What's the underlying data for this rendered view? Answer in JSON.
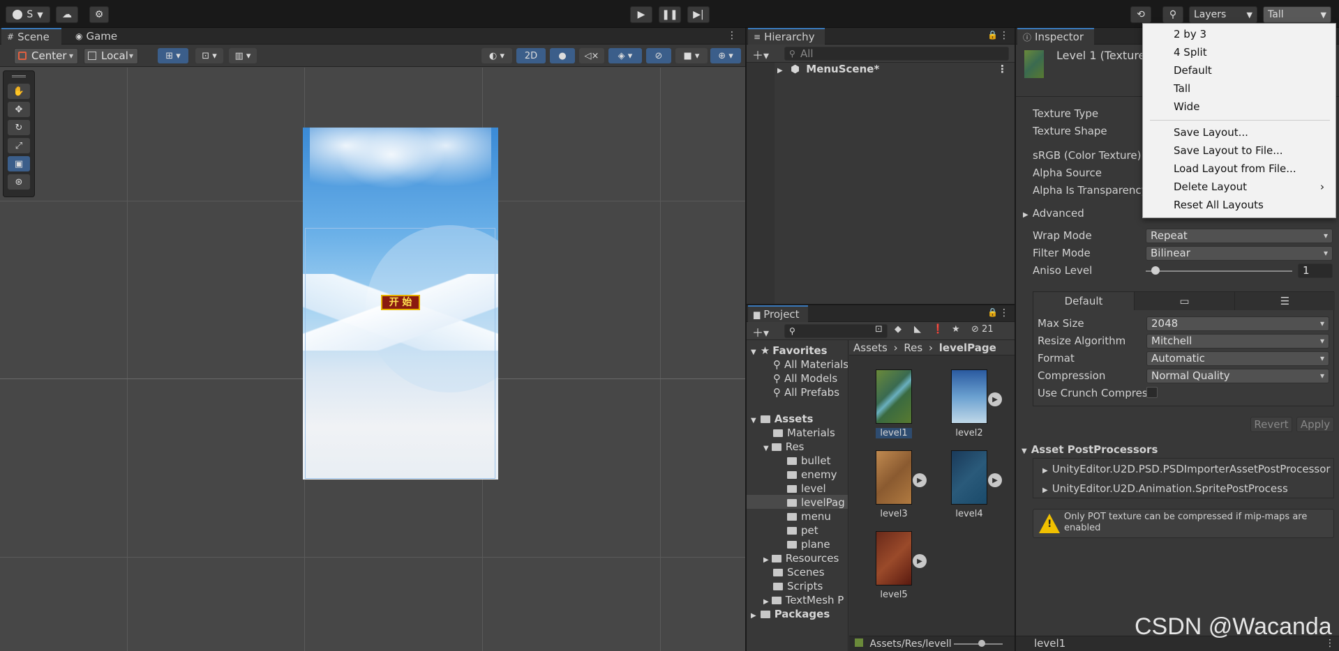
{
  "toolbar": {
    "account_label": "S",
    "layers_label": "Layers",
    "layout_label": "Tall"
  },
  "scene_panel": {
    "tabs": [
      "Scene",
      "Game"
    ],
    "pivot_label": "Center",
    "space_label": "Local",
    "mode_2d_label": "2D",
    "start_button_text": "开 始"
  },
  "hierarchy": {
    "title": "Hierarchy",
    "search_placeholder": "All",
    "root_item": "MenuScene*"
  },
  "project": {
    "title": "Project",
    "hidden_count": "21",
    "favorites_label": "Favorites",
    "favorites": [
      "All Materials",
      "All Models",
      "All Prefabs"
    ],
    "assets_label": "Assets",
    "tree": [
      "Materials",
      "Res",
      "bullet",
      "enemy",
      "level",
      "levelPag",
      "menu",
      "pet",
      "plane",
      "Resources",
      "Scenes",
      "Scripts",
      "TextMesh P"
    ],
    "packages_label": "Packages",
    "breadcrumb": [
      "Assets",
      "Res",
      "levelPage"
    ],
    "thumbnails": [
      "level1",
      "level2",
      "level3",
      "level4",
      "level5"
    ],
    "footer_path": "Assets/Res/levell"
  },
  "inspector": {
    "title": "Inspector",
    "asset_title": "Level 1 (Texture",
    "props": [
      "Texture Type",
      "Texture Shape",
      "sRGB (Color Texture)",
      "Alpha Source",
      "Alpha Is Transparency"
    ],
    "advanced_label": "Advanced",
    "wrap_mode_label": "Wrap Mode",
    "wrap_mode_value": "Repeat",
    "filter_mode_label": "Filter Mode",
    "filter_mode_value": "Bilinear",
    "aniso_label": "Aniso Level",
    "aniso_value": "1",
    "platform_default_tab": "Default",
    "max_size_label": "Max Size",
    "max_size_value": "2048",
    "resize_label": "Resize Algorithm",
    "resize_value": "Mitchell",
    "format_label": "Format",
    "format_value": "Automatic",
    "compression_label": "Compression",
    "compression_value": "Normal Quality",
    "crunch_label": "Use Crunch Compress",
    "revert_label": "Revert",
    "apply_label": "Apply",
    "postprocessors_label": "Asset PostProcessors",
    "postprocessors": [
      "UnityEditor.U2D.PSD.PSDImporterAssetPostProcessor",
      "UnityEditor.U2D.Animation.SpritePostProcess"
    ],
    "warning_text": "Only POT texture can be compressed if mip-maps are enabled",
    "footer_name": "level1"
  },
  "layout_menu": {
    "items": [
      "2 by 3",
      "4 Split",
      "Default",
      "Tall",
      "Wide"
    ],
    "actions": [
      "Save Layout...",
      "Save Layout to File...",
      "Load Layout from File...",
      "Delete Layout",
      "Reset All Layouts"
    ]
  },
  "watermark": "CSDN @Wacanda"
}
